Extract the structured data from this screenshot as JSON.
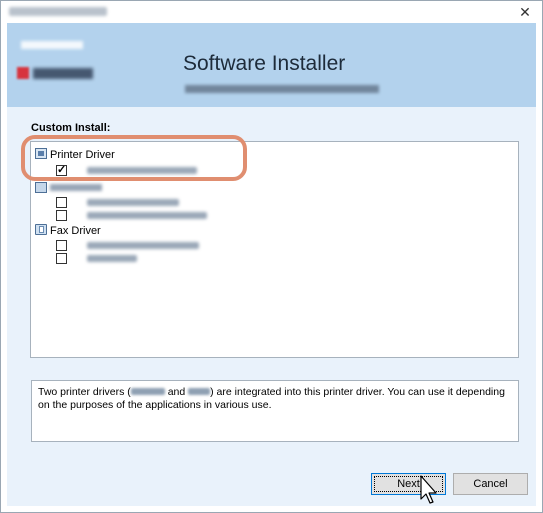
{
  "window": {
    "title": ""
  },
  "header": {
    "title": "Software Installer",
    "subtitle": ""
  },
  "custom_install_label": "Custom Install:",
  "groups": [
    {
      "name": "Printer Driver",
      "icon": "printer-driver-icon",
      "items": [
        {
          "checked": true
        }
      ]
    },
    {
      "name": "",
      "icon": "utility-icon",
      "items": [
        {
          "checked": false
        },
        {
          "checked": false
        }
      ]
    },
    {
      "name": "Fax Driver",
      "icon": "fax-driver-icon",
      "items": [
        {
          "checked": false
        },
        {
          "checked": false
        }
      ]
    }
  ],
  "description": {
    "part1": "Two printer drivers (",
    "part2": " and ",
    "part3": ") are integrated into this printer driver. You can use it depending on the purposes of the applications in various use."
  },
  "buttons": {
    "next": "Next",
    "cancel": "Cancel"
  },
  "colors": {
    "header_bg": "#b3d2ed",
    "panel_bg": "#e9f2fb",
    "highlight": "#e08e70",
    "focus_border": "#0078d7"
  }
}
